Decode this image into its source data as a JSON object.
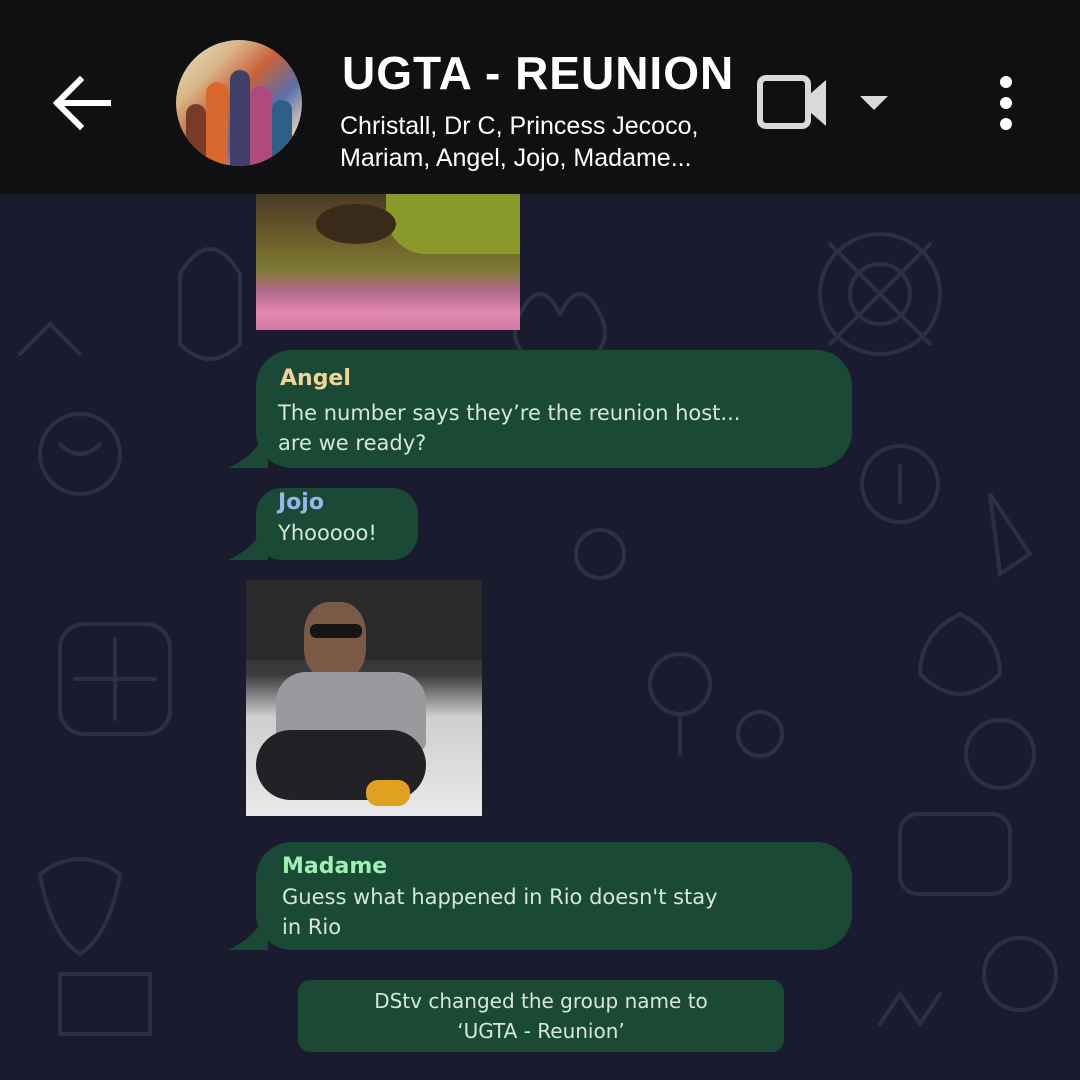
{
  "header": {
    "title": "UGTA - REUNION",
    "participants_line1": "Christall, Dr C, Princess Jecoco,",
    "participants_line2": "Mariam, Angel, Jojo, Madame..."
  },
  "icons": {
    "back": "arrow-left",
    "video_call": "video-camera",
    "call_options": "caret-down",
    "more": "vertical-ellipsis"
  },
  "messages": [
    {
      "sender": "Angel",
      "sender_color": "#f5d29a",
      "lines": [
        "The number says they’re the reunion host...",
        "are we ready?"
      ]
    },
    {
      "sender": "Jojo",
      "sender_color": "#9ab4f2",
      "lines": [
        "Yhooooo!"
      ]
    },
    {
      "sender": "Madame",
      "sender_color": "#9ef0b4",
      "lines": [
        "Guess what happened in Rio doesn't stay",
        "in Rio"
      ]
    }
  ],
  "system_message": {
    "line1": "DStv changed the group name to",
    "line2": "‘UGTA - Reunion’"
  },
  "colors": {
    "header_bg": "#0e1012",
    "chat_bg": "#1b1b30",
    "bubble_bg": "#1a4a36",
    "message_text": "#d7e6dc"
  }
}
